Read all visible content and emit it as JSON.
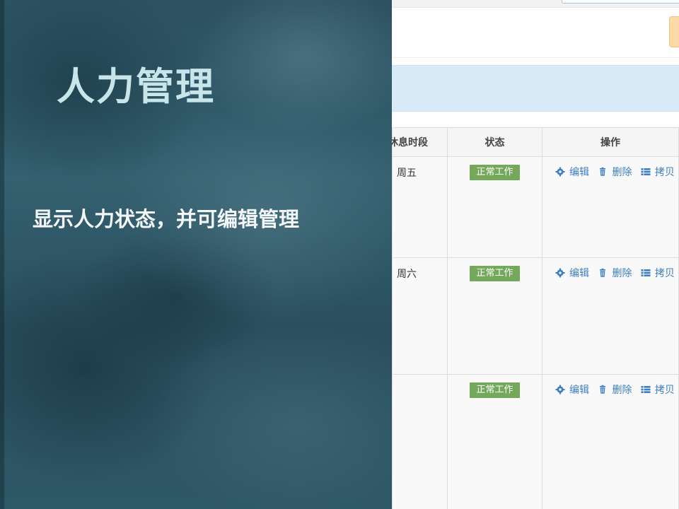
{
  "slide": {
    "title": "人力管理",
    "subtitle": "显示人力状态，并可编辑管理"
  },
  "table": {
    "headers": {
      "rest_period": "休息时段",
      "status": "状态",
      "actions": "操作"
    },
    "rows": [
      {
        "rest_day": "周五",
        "status": "正常工作"
      },
      {
        "rest_day": "周六",
        "status": "正常工作"
      },
      {
        "rest_day": "",
        "status": "正常工作"
      }
    ],
    "actions": {
      "edit": {
        "label": "编辑",
        "icon": "gear-icon"
      },
      "delete": {
        "label": "删除",
        "icon": "trash-icon"
      },
      "copy": {
        "label": "拷贝",
        "icon": "list-icon"
      }
    }
  },
  "colors": {
    "status_badge": "#74a95c",
    "action_link": "#3c7fc0",
    "panel_header": "#d9ebf7",
    "hero_background": "#2f5867"
  }
}
